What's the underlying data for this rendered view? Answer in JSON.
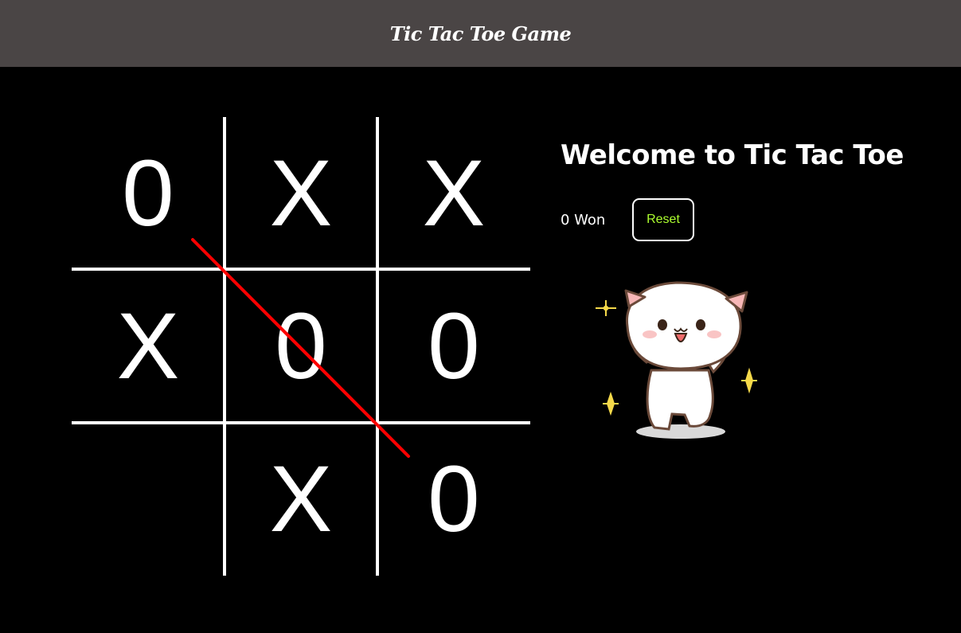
{
  "navbar": {
    "title": "Tic Tac Toe Game"
  },
  "board": {
    "cells": [
      "0",
      "X",
      "X",
      "X",
      "0",
      "0",
      "",
      "X",
      "0"
    ],
    "winning_line": "diagonal top-left to bottom-right",
    "line_color": "#ff0000"
  },
  "info": {
    "heading": "Welcome to Tic Tac Toe",
    "won_text": "0 Won",
    "reset_label": "Reset",
    "celebration_icon": "dancing-cat-icon"
  },
  "colors": {
    "navbar_bg": "#4a4545",
    "page_bg": "#000000",
    "reset_text": "#adff2f"
  }
}
